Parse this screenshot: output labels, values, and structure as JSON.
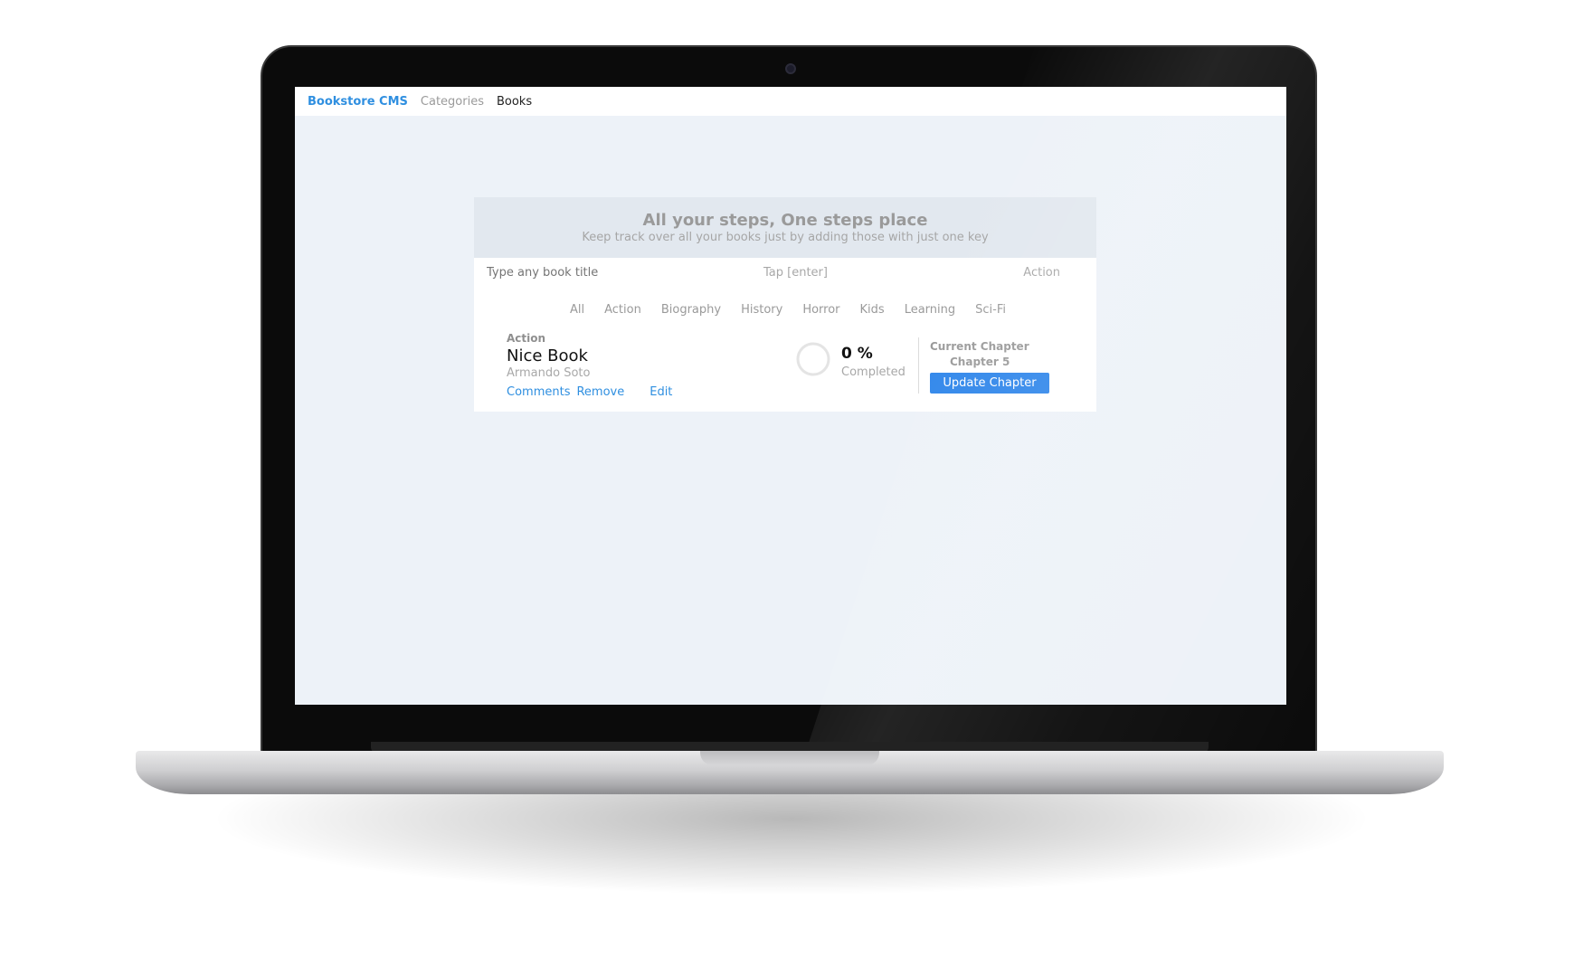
{
  "navbar": {
    "brand": "Bookstore CMS",
    "links": [
      {
        "label": "Categories",
        "active": false
      },
      {
        "label": "Books",
        "active": true
      }
    ]
  },
  "header": {
    "title": "All your steps, One steps place",
    "subtitle": "Keep track over all your books just by adding those with just one key"
  },
  "add_form": {
    "title_placeholder": "Type any book title",
    "enter_hint": "Tap [enter]",
    "category_selected": "Action"
  },
  "filters": [
    "All",
    "Action",
    "Biography",
    "History",
    "Horror",
    "Kids",
    "Learning",
    "Sci-Fi"
  ],
  "books": [
    {
      "category": "Action",
      "title": "Nice Book",
      "author": "Armando Soto",
      "actions": {
        "comments": "Comments",
        "remove": "Remove",
        "edit": "Edit"
      },
      "progress_percent": 0,
      "progress_text": "0 %",
      "progress_label": "Completed",
      "chapter_label": "Current Chapter",
      "chapter_value": "Chapter 5",
      "update_label": "Update Chapter"
    }
  ],
  "colors": {
    "accent": "#2f8fe0",
    "button": "#2f86ea",
    "screen_bg": "#edf2f8",
    "header_bg": "#e2e8ef"
  },
  "icons": {
    "progress": "progress-ring-icon",
    "camera": "camera-icon"
  }
}
